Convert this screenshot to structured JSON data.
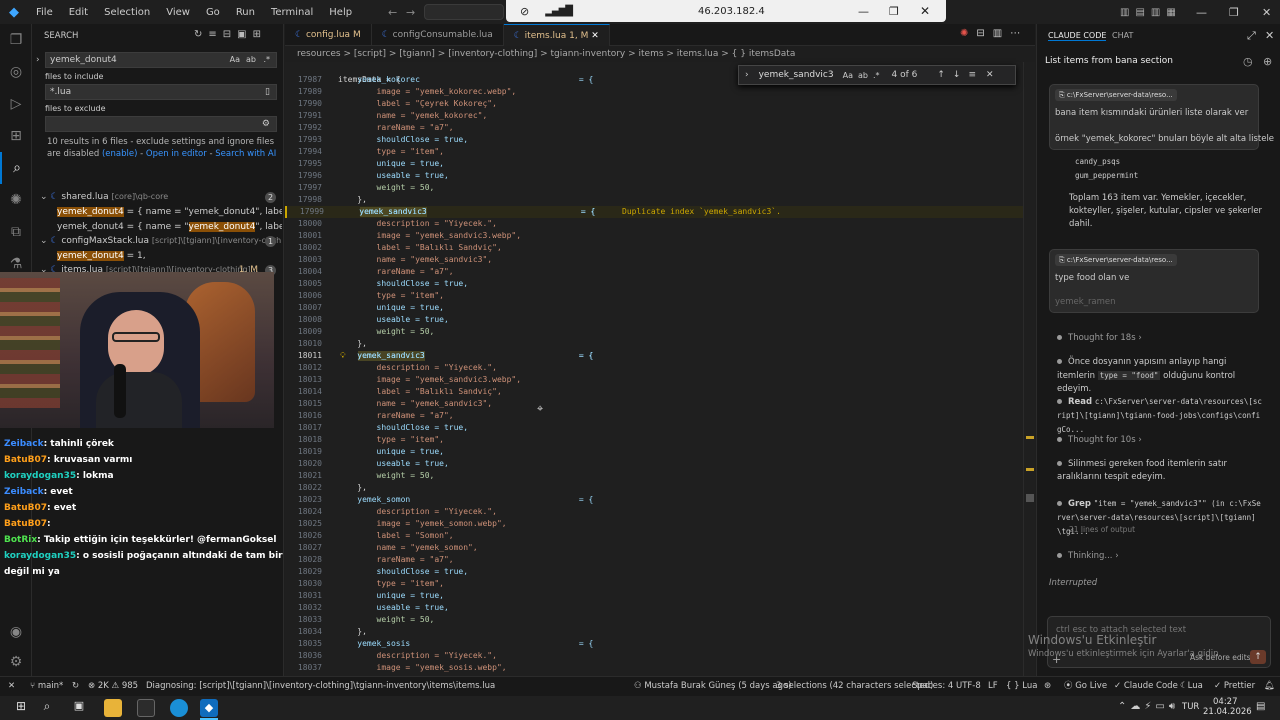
{
  "titlebar": {
    "menu": [
      "File",
      "Edit",
      "Selection",
      "View",
      "Go",
      "Run",
      "Terminal",
      "Help"
    ],
    "remote_ip": "46.203.182.4"
  },
  "sidebar": {
    "title": "SEARCH",
    "search_value": "yemek_donut4",
    "files_include_label": "files to include",
    "files_include_value": "*.lua",
    "files_exclude_label": "files to exclude",
    "results_text": "10 results in 6 files - exclude settings and ignore files are disabled",
    "results_link_enable": "(enable)",
    "results_link_open": "Open in editor",
    "results_link_ai": "Search with AI",
    "tree": [
      {
        "kind": "file",
        "name": "shared.lua",
        "path": "[core]\\qb-core",
        "count": "2"
      },
      {
        "kind": "match",
        "pre": "",
        "hit": "yemek_donut4",
        "post": " = { name = \"yemek_donut4\", label = ..."
      },
      {
        "kind": "match",
        "pre": "yemek_donut4 = { name = \"",
        "hit": "yemek_donut4",
        "post": "\", label = ..."
      },
      {
        "kind": "file",
        "name": "configMaxStack.lua",
        "path": "[script]\\[tgiann]\\[inventory-clothi...",
        "count": "1"
      },
      {
        "kind": "match",
        "pre": "",
        "hit": "yemek_donut4",
        "post": " = 1,"
      },
      {
        "kind": "file",
        "name": "items.lua",
        "path": "[script]\\[tgiann]\\[inventory-clothing]...",
        "count": "3",
        "mod": "1, M"
      },
      {
        "kind": "match",
        "pre": "",
        "hit": "yemek_donut4",
        "post": " = {"
      }
    ]
  },
  "chat": [
    {
      "user": "Zeiback",
      "text": ": tahinli çörek",
      "color": "#3b8cff"
    },
    {
      "user": "BatuB07",
      "text": ": kruvasan varmı",
      "color": "#ff9f1a"
    },
    {
      "user": "koraydogan35",
      "text": ": lokma",
      "color": "#1fd1c1"
    },
    {
      "user": "Zeiback",
      "text": ": evet",
      "color": "#3b8cff"
    },
    {
      "user": "BatuB07",
      "text": ": evet",
      "color": "#ff9f1a"
    },
    {
      "user": "BatuB07",
      "text": ":",
      "color": "#ff9f1a"
    },
    {
      "user": "BotRix",
      "text": ": Takip ettiğin için teşekkürler! @fermanGoksel",
      "color": "#4fe34f"
    },
    {
      "user": "koraydogan35",
      "text": ": o sosisli poğaçanın altındaki de tam bir lokma",
      "color": "#1fd1c1"
    },
    {
      "user": "",
      "text": "değil mi ya",
      "color": "#ffffff"
    }
  ],
  "tabs": [
    {
      "name": "config.lua",
      "mod": "M",
      "active": false
    },
    {
      "name": "configConsumable.lua",
      "mod": "",
      "active": false
    },
    {
      "name": "items.lua",
      "mod": "1, M",
      "active": true
    }
  ],
  "breadcrumb": "resources > [script] > [tgiann] > [inventory-clothing] > tgiann-inventory > items > items.lua > { } itemsData",
  "find": {
    "value": "yemek_sandvic3",
    "count": "4 of 6",
    "aa": "Aa",
    "ab": "ab"
  },
  "code_header": "itemsData = {",
  "code": [
    {
      "n": "17987",
      "t": "    yemek_kokorec                                 = {",
      "type": "key"
    },
    {
      "n": "17989",
      "t": "        image = \"yemek_kokorec.webp\",",
      "type": "kv"
    },
    {
      "n": "17990",
      "t": "        label = \"Çeyrek Kokoreç\",",
      "type": "kv"
    },
    {
      "n": "17991",
      "t": "        name = \"yemek_kokorec\",",
      "type": "kv"
    },
    {
      "n": "17992",
      "t": "        rareName = \"a7\",",
      "type": "kv"
    },
    {
      "n": "17993",
      "t": "        shouldClose = true,",
      "type": "kvb"
    },
    {
      "n": "17994",
      "t": "        type = \"item\",",
      "type": "kv"
    },
    {
      "n": "17995",
      "t": "        unique = true,",
      "type": "kvb"
    },
    {
      "n": "17996",
      "t": "        useable = true,",
      "type": "kvb"
    },
    {
      "n": "17997",
      "t": "        weight = 50,",
      "type": "kvn"
    },
    {
      "n": "17998",
      "t": "    },",
      "type": "p"
    },
    {
      "n": "17999",
      "t": "    yemek_sandvic3                                = {",
      "type": "keyhl",
      "err": "Duplicate index `yemek_sandvic3`."
    },
    {
      "n": "18000",
      "t": "        description = \"Yiyecek.\",",
      "type": "kv"
    },
    {
      "n": "18001",
      "t": "        image = \"yemek_sandvic3.webp\",",
      "type": "kv"
    },
    {
      "n": "18002",
      "t": "        label = \"Balıklı Sandviç\",",
      "type": "kv"
    },
    {
      "n": "18003",
      "t": "        name = \"yemek_sandvic3\",",
      "type": "kv"
    },
    {
      "n": "18004",
      "t": "        rareName = \"a7\",",
      "type": "kv"
    },
    {
      "n": "18005",
      "t": "        shouldClose = true,",
      "type": "kvb"
    },
    {
      "n": "18006",
      "t": "        type = \"item\",",
      "type": "kv"
    },
    {
      "n": "18007",
      "t": "        unique = true,",
      "type": "kvb"
    },
    {
      "n": "18008",
      "t": "        useable = true,",
      "type": "kvb"
    },
    {
      "n": "18009",
      "t": "        weight = 50,",
      "type": "kvn"
    },
    {
      "n": "18010",
      "t": "    },",
      "type": "p"
    },
    {
      "n": "18011",
      "t": "    yemek_sandvic3                                = {",
      "type": "keyhl",
      "cur": true
    },
    {
      "n": "18012",
      "t": "        description = \"Yiyecek.\",",
      "type": "kv"
    },
    {
      "n": "18013",
      "t": "        image = \"yemek_sandvic3.webp\",",
      "type": "kv"
    },
    {
      "n": "18014",
      "t": "        label = \"Balıklı Sandviç\",",
      "type": "kv"
    },
    {
      "n": "18015",
      "t": "        name = \"yemek_sandvic3\",",
      "type": "kv"
    },
    {
      "n": "18016",
      "t": "        rareName = \"a7\",",
      "type": "kv"
    },
    {
      "n": "18017",
      "t": "        shouldClose = true,",
      "type": "kvb"
    },
    {
      "n": "18018",
      "t": "        type = \"item\",",
      "type": "kv"
    },
    {
      "n": "18019",
      "t": "        unique = true,",
      "type": "kvb"
    },
    {
      "n": "18020",
      "t": "        useable = true,",
      "type": "kvb"
    },
    {
      "n": "18021",
      "t": "        weight = 50,",
      "type": "kvn"
    },
    {
      "n": "18022",
      "t": "    },",
      "type": "p"
    },
    {
      "n": "18023",
      "t": "    yemek_somon                                   = {",
      "type": "key"
    },
    {
      "n": "18024",
      "t": "        description = \"Yiyecek.\",",
      "type": "kv"
    },
    {
      "n": "18025",
      "t": "        image = \"yemek_somon.webp\",",
      "type": "kv"
    },
    {
      "n": "18026",
      "t": "        label = \"Somon\",",
      "type": "kv"
    },
    {
      "n": "18027",
      "t": "        name = \"yemek_somon\",",
      "type": "kv"
    },
    {
      "n": "18028",
      "t": "        rareName = \"a7\",",
      "type": "kv"
    },
    {
      "n": "18029",
      "t": "        shouldClose = true,",
      "type": "kvb"
    },
    {
      "n": "18030",
      "t": "        type = \"item\",",
      "type": "kv"
    },
    {
      "n": "18031",
      "t": "        unique = true,",
      "type": "kvb"
    },
    {
      "n": "18032",
      "t": "        useable = true,",
      "type": "kvb"
    },
    {
      "n": "18033",
      "t": "        weight = 50,",
      "type": "kvn"
    },
    {
      "n": "18034",
      "t": "    },",
      "type": "p"
    },
    {
      "n": "18035",
      "t": "    yemek_sosis                                   = {",
      "type": "key"
    },
    {
      "n": "18036",
      "t": "        description = \"Yiyecek.\",",
      "type": "kv"
    },
    {
      "n": "18037",
      "t": "        image = \"yemek_sosis.webp\",",
      "type": "kv"
    },
    {
      "n": "18038",
      "t": "        label = \"Pane Sosis\",",
      "type": "kv"
    }
  ],
  "right": {
    "tab_claude": "CLAUDE CODE",
    "tab_chat": "CHAT",
    "heading": "List items from bana section",
    "msg1_path": "c:\\FxServer\\server-data\\reso...",
    "msg1_line1": "bana item kısmındaki ürünleri liste olarak ver",
    "msg1_line2": "örnek \"yemek_kokorec\" bnuları böyle alt alta listele",
    "code1": "candy_psqs",
    "code2": "gum_peppermint",
    "summary": "Toplam 163 item var. Yemekler, içecekler, kokteyller, şişeler, kutular, cipsler ve şekerler dahil.",
    "msg2_path": "c:\\FxServer\\server-data\\reso...",
    "msg2_line1": "type food olan ve",
    "msg2_line2": "yemek_ramen",
    "thought1": "Thought for 18s",
    "step1": "Önce dosyanın yapısını anlayıp hangi itemlerin",
    "step1_code": "type = \"food\"",
    "step1_tail": "olduğunu kontrol edeyim.",
    "read_label": "Read",
    "read_path": "c:\\FxServer\\server-data\\resources\\[script]\\[tgiann]\\tgiann-food-jobs\\configs\\configCo...",
    "thought2": "Thought for 10s",
    "step2": "Silinmesi gereken food itemlerin satır aralıklarını tespit edeyim.",
    "grep_label": "Grep",
    "grep_text": "\"item = \"yemek_sandvic3\"\" (in c:\\FxServer\\server-data\\resources\\[script]\\[tgiann]\\tgi...",
    "grep_out": "21 lines of output",
    "thinking": "Thinking...",
    "interrupted": "Interrupted",
    "input_placeholder": "ctrl esc to attach selected text",
    "watermark1": "Windows'u Etkinleştir",
    "watermark2": "Windows'u etkinleştirmek için Ayarlar'a gidin.",
    "ask_before": "Ask before edits"
  },
  "status": {
    "branch": "main*",
    "errors": "2K",
    "warnings": "985",
    "diag": "Diagnosing: [script]\\[tgiann]\\[inventory-clothing]\\tgiann-inventory\\items\\items.lua",
    "author": "Mustafa Burak Güneş (5 days ago)",
    "selections": "3 selections (42 characters selected)",
    "spaces": "Spaces: 4",
    "encoding": "UTF-8",
    "eol": "LF",
    "lang": "Lua",
    "golive": "Go Live",
    "claude": "Claude Code",
    "lua2": "Lua",
    "prettier": "Prettier"
  },
  "taskbar": {
    "lang": "TUR",
    "time": "04:27",
    "date": "21.04.2026"
  },
  "colors": {
    "accent": "#0078d4",
    "match_bg": "#8a4f06",
    "warning": "#cca700"
  }
}
